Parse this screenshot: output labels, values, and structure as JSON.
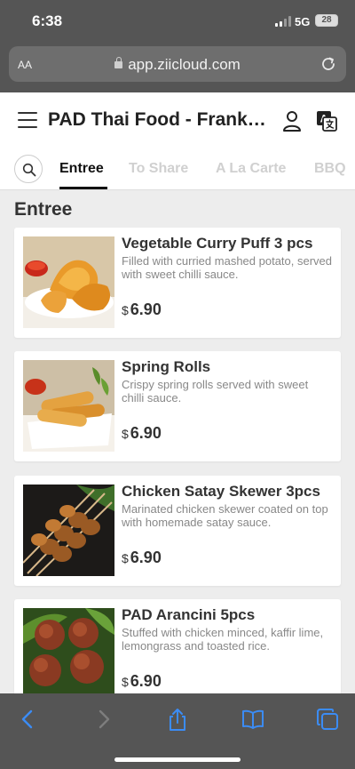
{
  "status_bar": {
    "time": "6:38",
    "network": "5G",
    "battery": "28"
  },
  "browser": {
    "aa_label": "AA",
    "url": "app.ziicloud.com"
  },
  "header": {
    "title": "PAD Thai Food - Frankston"
  },
  "tabs": [
    {
      "label": "Entree",
      "active": true
    },
    {
      "label": "To Share",
      "active": false
    },
    {
      "label": "A La Carte",
      "active": false
    },
    {
      "label": "BBQ",
      "active": false
    }
  ],
  "section": {
    "title": "Entree"
  },
  "menu_items": [
    {
      "name": "Vegetable Curry Puff 3 pcs",
      "description": "Filled with curried mashed potato, served with sweet chilli sauce.",
      "currency": "$",
      "price": "6.90",
      "image": "curry-puff-photo"
    },
    {
      "name": "Spring Rolls",
      "description": "Crispy spring rolls served with sweet chilli sauce.",
      "currency": "$",
      "price": "6.90",
      "image": "spring-rolls-photo"
    },
    {
      "name": "Chicken Satay Skewer 3pcs",
      "description": "Marinated chicken skewer coated on top with homemade satay sauce.",
      "currency": "$",
      "price": "6.90",
      "image": "satay-skewer-photo"
    },
    {
      "name": "PAD Arancini 5pcs",
      "description": "Stuffed with chicken minced, kaffir lime, lemongrass and toasted rice.",
      "currency": "$",
      "price": "6.90",
      "image": "arancini-photo"
    }
  ],
  "icons": {
    "menu": "hamburger-menu-icon",
    "user": "user-icon",
    "translate": "translate-icon",
    "search": "search-icon",
    "back": "back-arrow-icon",
    "forward": "forward-arrow-icon",
    "share": "share-icon",
    "bookmarks": "bookmarks-icon",
    "tabs": "tabs-icon"
  },
  "colors": {
    "accent_ios": "#3b8cf5",
    "tab_active": "#111111",
    "tab_inactive": "#d0d0d0",
    "browser_chrome": "#555555"
  }
}
